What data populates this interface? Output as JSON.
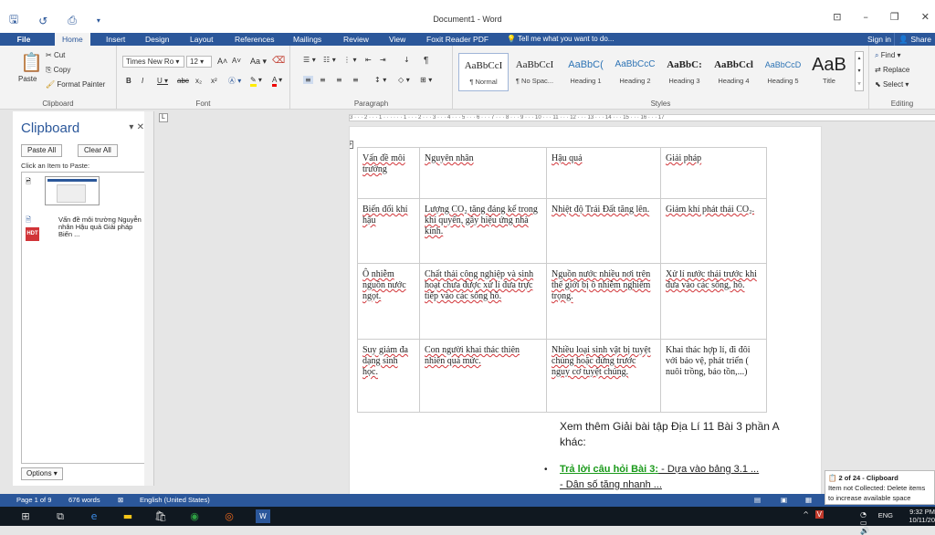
{
  "window": {
    "title": "Document1 - Word"
  },
  "tabs": {
    "file": "File",
    "home": "Home",
    "insert": "Insert",
    "design": "Design",
    "layout": "Layout",
    "references": "References",
    "mailings": "Mailings",
    "review": "Review",
    "view": "View",
    "foxit": "Foxit Reader PDF",
    "tell_me": "Tell me what you want to do...",
    "sign_in": "Sign in",
    "share": "Share"
  },
  "ribbon": {
    "clipboard": {
      "paste": "Paste",
      "cut": "Cut",
      "copy": "Copy",
      "format_painter": "Format Painter",
      "label": "Clipboard"
    },
    "font": {
      "name": "Times New Ro",
      "size": "12",
      "label": "Font",
      "change_case": "Aa",
      "grow": "A",
      "shrink": "A"
    },
    "paragraph": {
      "label": "Paragraph"
    },
    "styles": {
      "label": "Styles",
      "items": [
        {
          "preview": "AaBbCcI",
          "name": "¶ Normal"
        },
        {
          "preview": "AaBbCcI",
          "name": "¶ No Spac..."
        },
        {
          "preview": "AaBbC(",
          "name": "Heading 1"
        },
        {
          "preview": "AaBbCcC",
          "name": "Heading 2"
        },
        {
          "preview": "AaBbC:",
          "name": "Heading 3"
        },
        {
          "preview": "AaBbCcl",
          "name": "Heading 4"
        },
        {
          "preview": "AaBbCcD",
          "name": "Heading 5"
        },
        {
          "preview": "AaB",
          "name": "Title"
        }
      ]
    },
    "editing": {
      "find": "Find",
      "replace": "Replace",
      "select": "Select",
      "label": "Editing"
    }
  },
  "clipboard_pane": {
    "title": "Clipboard",
    "paste_all": "Paste All",
    "clear_all": "Clear All",
    "hint": "Click an Item to Paste:",
    "item_text": "Vấn đề môi trường Nguyễn nhân Hậu quả Giải pháp Biến ...",
    "options": "Options"
  },
  "ruler": {
    "text": "3 · · · 2 · · · 1 · · ·   · · · 1 · · · 2 · · · 3 · · · 4 · · · 5 · · · 6 · · · 7 · · · 8 · · · 9 · · · 10 · · · 11 · · · 12 · · · 13 · · · 14 · · · 15 · · · 16 · · · 17"
  },
  "table": {
    "header": [
      "Vấn đề môi trường",
      "Nguyên nhân",
      "Hậu quả",
      "Giải pháp"
    ],
    "rows": [
      [
        "Biến đổi khí hậu",
        "Lượng CO₂ tăng đáng kể trong khí quyển, gây hiệu ứng nhà kính.",
        "Nhiệt độ Trái Đất tăng lên.",
        "Giảm khí phát thải CO₂."
      ],
      [
        "Ô nhiễm nguồn nước ngọt.",
        "Chất thải công nghiệp và sinh hoạt chưa được xử lí đưa trực tiếp vào các sông hồ.",
        "Nguồn nước nhiều nơi trên thế giới bị ô nhiễm nghiêm trọng.",
        "Xử lí nước thải trước khi đưa vào các sông, hồ."
      ],
      [
        "Suy giảm đa dạng sinh học.",
        "Con người khai thác thiên nhiên quá mức.",
        "Nhiều loại sinh vật bị tuyệt chủng hoặc đứng trước nguy cơ tuyệt chủng.",
        "Khai thác hợp lí, đi đôi với bảo vệ, phát triển ( nuôi trồng, bảo tồn,...)"
      ]
    ]
  },
  "after_text": "Xem thêm Giải bài tập Địa Lí 11 Bài 3 phần A khác:",
  "bullet": {
    "title": "Trả lời câu hỏi Bài 3:",
    "rest": " - Dựa vào bảng 3.1 ...",
    "line2": "- Dân số tăng nhanh ..."
  },
  "status": {
    "page": "Page 1 of 9",
    "words": "676 words",
    "language": "English (United States)"
  },
  "toast": {
    "title": "2 of 24 - Clipboard",
    "body": "Item not Collected: Delete items to increase available space"
  },
  "tray": {
    "lang": "ENG",
    "time": "9:32 PM",
    "date": "10/11/20"
  }
}
